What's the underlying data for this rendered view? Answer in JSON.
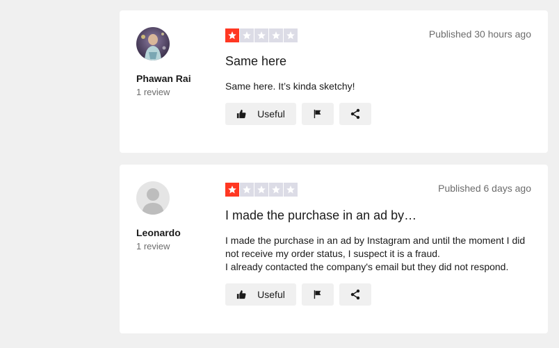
{
  "reviews": [
    {
      "author_name": "Phawan Rai",
      "author_reviews": "1 review",
      "rating": 1,
      "published": "Published 30 hours ago",
      "title": "Same here",
      "body": [
        "Same here. It’s kinda sketchy!"
      ],
      "useful_label": "Useful"
    },
    {
      "author_name": "Leonardo",
      "author_reviews": "1 review",
      "rating": 1,
      "published": "Published 6 days ago",
      "title": "I made the purchase in an ad by…",
      "body": [
        "I made the purchase in an ad by Instagram and until the moment I did",
        "not receive my order status, I suspect it is a fraud.",
        "I already contacted the company's email but they did not respond."
      ],
      "useful_label": "Useful"
    }
  ],
  "icons": {
    "useful": "thumbs-up-icon",
    "flag": "flag-icon",
    "share": "share-icon",
    "star": "star-icon"
  },
  "colors": {
    "star_on": "#ff3722",
    "star_off": "#dcdce6",
    "button_bg": "#f0f0f0",
    "page_bg": "#f0f0f0"
  }
}
